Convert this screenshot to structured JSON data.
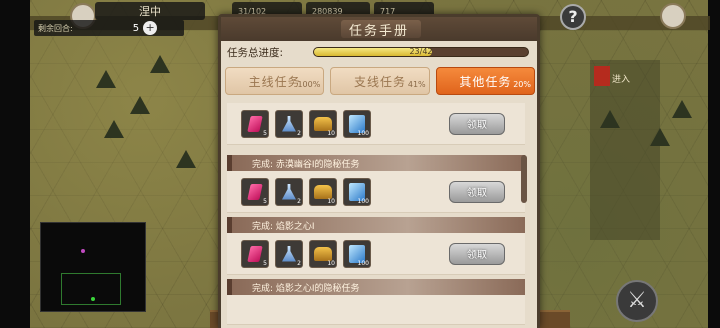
{
  "hud": {
    "title": "涅中",
    "resource1": "31/102",
    "resource2": "280839",
    "resource3": "717",
    "turns_label": "剩余回合:",
    "turns_value": "5",
    "plus": "+",
    "help": "?",
    "enter": "进入"
  },
  "modal": {
    "title": "任务手册",
    "progress_label": "任务总进度:",
    "progress_text": "23/42",
    "progress_fraction": 0.55,
    "tabs": [
      {
        "label": "主线任务",
        "pct": "100%",
        "active": false
      },
      {
        "label": "支线任务",
        "pct": "41%",
        "active": false
      },
      {
        "label": "其他任务",
        "pct": "20%",
        "active": true
      }
    ]
  },
  "tasks": [
    {
      "name": "",
      "rewards": [
        "5",
        "2",
        "10",
        "100"
      ],
      "button": "领取"
    },
    {
      "name": "完成: 赤漠幽谷I的隐秘任务",
      "rewards": [
        "5",
        "2",
        "10",
        "100"
      ],
      "button": "领取"
    },
    {
      "name": "完成: 焰影之心I",
      "rewards": [
        "5",
        "2",
        "10",
        "100"
      ],
      "button": "领取"
    },
    {
      "name": "完成: 焰影之心I的隐秘任务"
    }
  ],
  "icons": {
    "gem": "red-crystal-icon",
    "flask": "potion-icon",
    "chest": "gold-chest-icon",
    "book": "blue-book-icon"
  }
}
